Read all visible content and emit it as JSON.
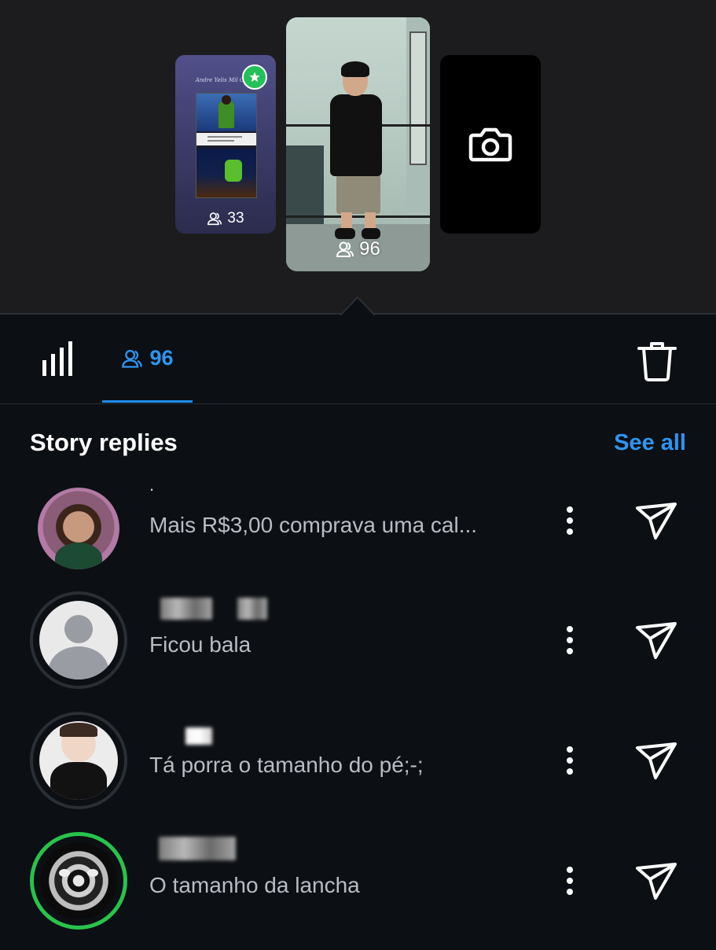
{
  "story_thumbs": [
    {
      "caption": "Andre Yelis Mil Gosto",
      "viewers": "33",
      "badge": "star-badge"
    },
    {
      "viewers": "96"
    },
    {
      "icon": "camera-icon"
    }
  ],
  "tabs": {
    "viewers_count": "96"
  },
  "section": {
    "title": "Story replies",
    "see_all": "See all"
  },
  "replies": [
    {
      "name": ".",
      "message": "Mais R$3,00 comprava uma cal..."
    },
    {
      "name": "",
      "message": "Ficou bala"
    },
    {
      "name": "",
      "message": "Tá porra o tamanho do pé;-;"
    },
    {
      "name": "",
      "message": "O tamanho da lancha"
    }
  ],
  "colors": {
    "accent": "#2e95f0",
    "background": "#0c0f14",
    "top_background": "#1c1c1e",
    "story_ring": "#28c34b"
  }
}
